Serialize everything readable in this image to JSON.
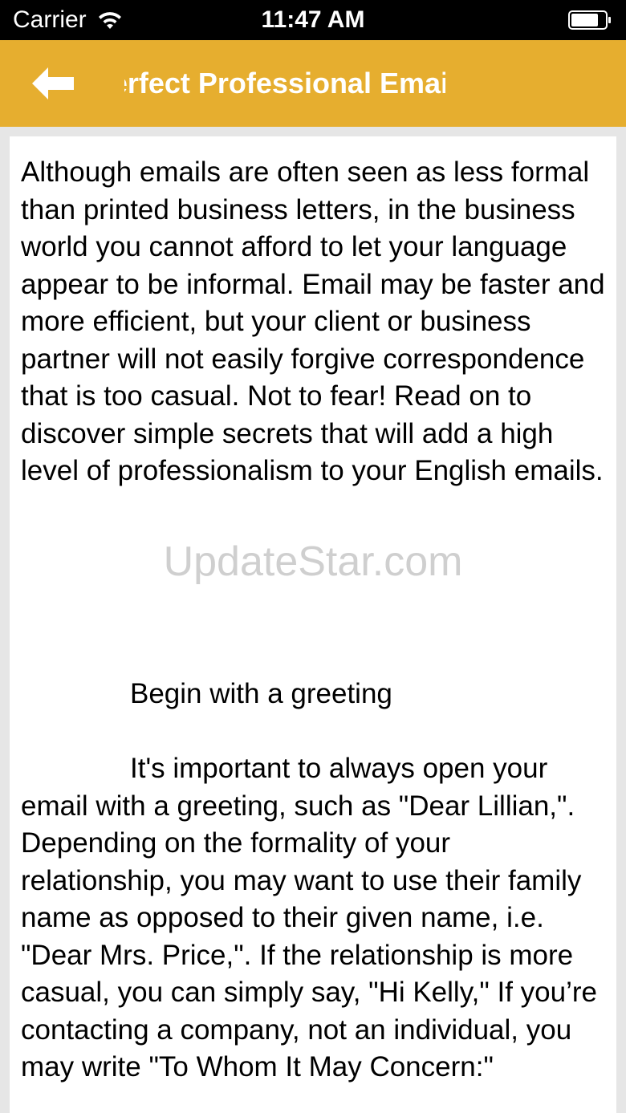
{
  "status_bar": {
    "carrier": "Carrier",
    "time": "11:47 AM"
  },
  "nav": {
    "title": "How to Write a Perfect Professional Email"
  },
  "article": {
    "intro": "Although emails are often seen as less formal than printed business letters, in the business world you cannot afford to let your language appear to be informal. Email may be faster and more efficient, but your client or business partner will not easily forgive correspondence that is too casual. Not to fear! Read on to discover simple secrets that will add a high level of professionalism to your English emails.",
    "section_heading": "Begin with a greeting",
    "section_body": "It's important to always open your email with a greeting, such as \"Dear Lillian,\". Depending on the formality of your relationship, you may want to use their family name as opposed to their given name, i.e. \"Dear Mrs. Price,\". If the relationship is more casual, you can simply say, \"Hi Kelly,\" If you’re contacting a company, not an individual, you may write \"To Whom It May Concern:\""
  },
  "watermark": "UpdateStar.com",
  "colors": {
    "nav_background": "#e6ae2f",
    "status_background": "#000000",
    "page_background": "#e6e6e6"
  },
  "icons": {
    "back": "left-arrow-icon",
    "wifi": "wifi-icon",
    "battery": "battery-icon"
  }
}
